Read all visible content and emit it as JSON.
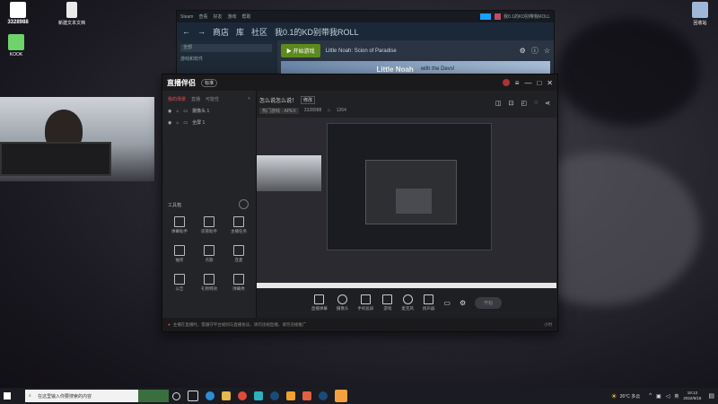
{
  "desktop": {
    "icon_id": {
      "name": "虎牙",
      "number": "3328988"
    },
    "icon_kook": "KOOK",
    "icon_newfile": "新建文本文档",
    "icon_recycle": "回收站"
  },
  "steam": {
    "menu": [
      "Steam",
      "查看",
      "好友",
      "游戏",
      "帮助"
    ],
    "user": "我0.1的KD别带我ROLL",
    "nav": [
      "商店",
      "库",
      "社区",
      "我0.1的KD别带我ROLL"
    ],
    "search_placeholder": "全部",
    "filter": "游戏和软件",
    "play_button": "开始游戏",
    "game_title": "Little Noah: Scion of Paradise",
    "banner_title": "Little Noah",
    "banner_text": "with the Devs!"
  },
  "studio": {
    "app_title": "直播伴侣",
    "badge": "标准",
    "tabs": [
      "我的场景",
      "直播",
      "可能性"
    ],
    "scenes": [
      "摄像头 1",
      "全屏 1"
    ],
    "stream_title": "怎么说怎么说！",
    "title_tag": "修改",
    "category": "热门游戏 · APEX",
    "room_id": "3328988",
    "viewers": "1264",
    "toolbox_label": "工具箱",
    "tools": [
      "弹幕助手",
      "房管助手",
      "主播任务",
      "抽奖",
      "点歌",
      "连麦",
      "公告",
      "礼物特效",
      "弹幕秀"
    ],
    "bottom_actions": [
      "直播弹幕",
      "摄像头",
      "手机投屏",
      "游戏",
      "麦克风",
      "扬声器"
    ],
    "start_button": "开始",
    "tip": "主播在直播时，需遵守平台规则与直播协议，请勿违规直播，请勿违规推广",
    "tip_right": "小时"
  },
  "taskbar": {
    "search_placeholder": "在这里输入你要搜索的内容",
    "weather": "26°C 多云",
    "time": "19:13",
    "date": "2022/6/18",
    "lang": "英"
  },
  "colors": {
    "accent": "#e04a4a",
    "steam_green": "#5c8a1c",
    "taskbar": "#1b1b22"
  }
}
